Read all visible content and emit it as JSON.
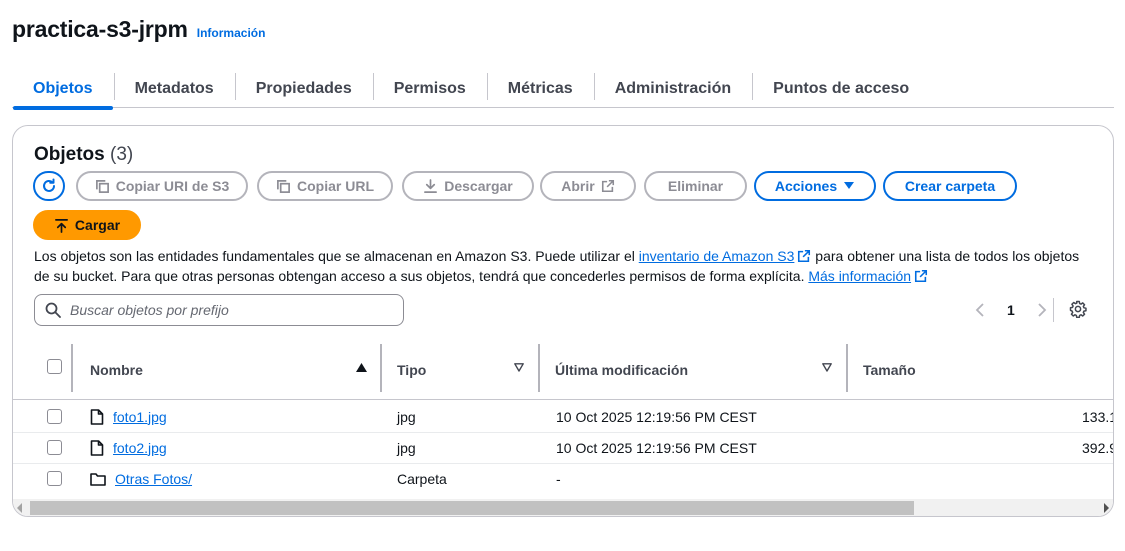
{
  "header": {
    "title": "practica-s3-jrpm",
    "info_link": "Información"
  },
  "tabs": [
    {
      "label": "Objetos"
    },
    {
      "label": "Metadatos"
    },
    {
      "label": "Propiedades"
    },
    {
      "label": "Permisos"
    },
    {
      "label": "Métricas"
    },
    {
      "label": "Administración"
    },
    {
      "label": "Puntos de acceso"
    }
  ],
  "objects_panel": {
    "title": "Objetos",
    "count": "(3)",
    "buttons": {
      "copy_uri": "Copiar URI de S3",
      "copy_url": "Copiar URL",
      "download": "Descargar",
      "open": "Abrir",
      "delete": "Eliminar",
      "actions": "Acciones",
      "create_folder": "Crear carpeta",
      "upload": "Cargar"
    },
    "description": {
      "part1": "Los objetos son las entidades fundamentales que se almacenan en Amazon S3. Puede utilizar el ",
      "inventory_link": "inventario de Amazon S3",
      "part2": " para obtener una lista de todos los objetos de su bucket. Para que otras personas obtengan acceso a sus objetos, tendrá que concederles permisos de forma explícita. ",
      "more_link": "Más información"
    },
    "search": {
      "placeholder": "Buscar objetos por prefijo",
      "value": ""
    },
    "pagination": {
      "current_page": "1"
    },
    "table": {
      "columns": {
        "name": "Nombre",
        "type": "Tipo",
        "modified": "Última modificación",
        "size": "Tamaño"
      },
      "rows": [
        {
          "name": "foto1.jpg",
          "icon": "file-icon",
          "type": "jpg",
          "modified": "10 Oct 2025 12:19:56 PM CEST",
          "size": "133.1"
        },
        {
          "name": "foto2.jpg",
          "icon": "file-icon",
          "type": "jpg",
          "modified": "10 Oct 2025 12:19:56 PM CEST",
          "size": "392.9"
        },
        {
          "name": "Otras Fotos/",
          "icon": "folder-icon",
          "type": "Carpeta",
          "modified": "-",
          "size": ""
        }
      ]
    }
  },
  "colors": {
    "accent": "#006ce0",
    "upload_button": "#ff9900",
    "disabled": "#8c8c94"
  }
}
